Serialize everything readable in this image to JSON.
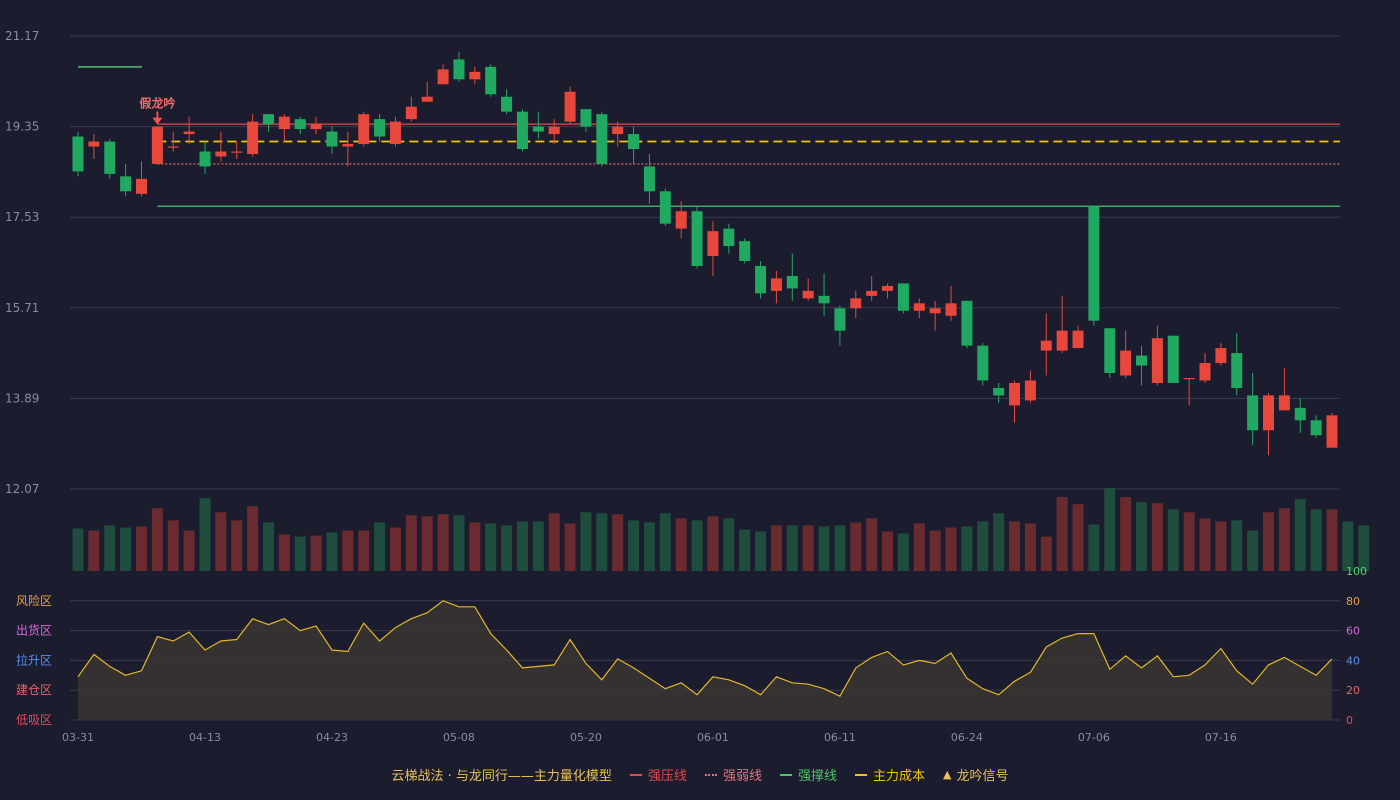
{
  "colors": {
    "background": "#1b1c2e",
    "up": "#e8483b",
    "down": "#21a861",
    "up_volume": "#6a2b30",
    "down_volume": "#1f4d3d",
    "grid": "#3a3b4e",
    "axis_text": "#8a8c9c",
    "pressure_line": "#e5484d",
    "weak_line": "#e5727a",
    "support_line": "#4cc36a",
    "cost_line": "#f1c40f",
    "indicator_line": "#e0b72a",
    "indicator_fill": "#3a3530"
  },
  "chart_data": {
    "type": "candlestick",
    "price_axis": {
      "ticks": [
        "21.17",
        "19.35",
        "17.53",
        "15.71",
        "13.89",
        "12.07"
      ],
      "ylim": [
        12.07,
        21.17
      ]
    },
    "x_tick_labels": [
      {
        "index": 0,
        "label": "03-31"
      },
      {
        "index": 8,
        "label": "04-13"
      },
      {
        "index": 16,
        "label": "04-23"
      },
      {
        "index": 24,
        "label": "05-08"
      },
      {
        "index": 32,
        "label": "05-20"
      },
      {
        "index": 40,
        "label": "06-01"
      },
      {
        "index": 48,
        "label": "06-11"
      },
      {
        "index": 56,
        "label": "06-24"
      },
      {
        "index": 64,
        "label": "07-06"
      },
      {
        "index": 72,
        "label": "07-16"
      }
    ],
    "candles": [
      [
        19.15,
        18.45,
        19.25,
        18.35
      ],
      [
        18.95,
        19.05,
        19.2,
        18.7
      ],
      [
        19.05,
        18.4,
        19.1,
        18.3
      ],
      [
        18.35,
        18.05,
        18.6,
        17.95
      ],
      [
        18.0,
        18.3,
        18.65,
        17.95
      ],
      [
        18.6,
        19.35,
        19.35,
        18.6
      ],
      [
        18.95,
        18.95,
        19.25,
        18.85
      ],
      [
        19.2,
        19.25,
        19.55,
        19.0
      ],
      [
        18.85,
        18.55,
        19.05,
        18.4
      ],
      [
        18.75,
        18.85,
        19.25,
        18.65
      ],
      [
        18.85,
        18.85,
        19.05,
        18.7
      ],
      [
        18.8,
        19.45,
        19.6,
        18.75
      ],
      [
        19.6,
        19.4,
        19.6,
        19.25
      ],
      [
        19.3,
        19.55,
        19.6,
        19.05
      ],
      [
        19.5,
        19.3,
        19.55,
        19.2
      ],
      [
        19.3,
        19.4,
        19.55,
        19.2
      ],
      [
        19.25,
        18.95,
        19.35,
        18.8
      ],
      [
        18.95,
        19.0,
        19.25,
        18.55
      ],
      [
        19.0,
        19.6,
        19.65,
        18.95
      ],
      [
        19.5,
        19.15,
        19.6,
        19.05
      ],
      [
        19.0,
        19.45,
        19.55,
        18.95
      ],
      [
        19.5,
        19.75,
        19.95,
        19.45
      ],
      [
        19.85,
        19.95,
        20.25,
        19.85
      ],
      [
        20.2,
        20.5,
        20.6,
        20.2
      ],
      [
        20.7,
        20.3,
        20.85,
        20.25
      ],
      [
        20.3,
        20.45,
        20.55,
        20.2
      ],
      [
        20.55,
        20.0,
        20.6,
        19.95
      ],
      [
        19.95,
        19.65,
        20.1,
        19.6
      ],
      [
        19.65,
        18.9,
        19.7,
        18.85
      ],
      [
        19.35,
        19.25,
        19.65,
        19.1
      ],
      [
        19.2,
        19.35,
        19.5,
        19.0
      ],
      [
        19.45,
        20.05,
        20.15,
        19.4
      ],
      [
        19.7,
        19.35,
        19.7,
        19.25
      ],
      [
        19.6,
        18.6,
        19.65,
        18.55
      ],
      [
        19.2,
        19.35,
        19.45,
        18.95
      ],
      [
        19.2,
        18.9,
        19.35,
        18.6
      ],
      [
        18.55,
        18.05,
        18.8,
        17.8
      ],
      [
        18.05,
        17.4,
        18.1,
        17.35
      ],
      [
        17.3,
        17.65,
        17.85,
        17.1
      ],
      [
        17.65,
        16.55,
        17.75,
        16.5
      ],
      [
        16.75,
        17.25,
        17.45,
        16.35
      ],
      [
        17.3,
        16.95,
        17.4,
        16.8
      ],
      [
        17.05,
        16.65,
        17.1,
        16.6
      ],
      [
        16.55,
        16.0,
        16.65,
        15.9
      ],
      [
        16.05,
        16.3,
        16.45,
        15.8
      ],
      [
        16.35,
        16.1,
        16.8,
        15.85
      ],
      [
        15.9,
        16.05,
        16.3,
        15.85
      ],
      [
        15.95,
        15.8,
        16.4,
        15.55
      ],
      [
        15.7,
        15.25,
        15.75,
        14.95
      ],
      [
        15.7,
        15.9,
        16.05,
        15.5
      ],
      [
        15.95,
        16.05,
        16.35,
        15.85
      ],
      [
        16.05,
        16.15,
        16.2,
        15.9
      ],
      [
        16.2,
        15.65,
        16.2,
        15.6
      ],
      [
        15.65,
        15.8,
        15.9,
        15.5
      ],
      [
        15.6,
        15.7,
        15.85,
        15.25
      ],
      [
        15.55,
        15.8,
        16.15,
        15.45
      ],
      [
        15.85,
        14.95,
        15.85,
        14.9
      ],
      [
        14.95,
        14.25,
        15.0,
        14.15
      ],
      [
        14.1,
        13.95,
        14.2,
        13.8
      ],
      [
        13.75,
        14.2,
        14.25,
        13.4
      ],
      [
        13.85,
        14.25,
        14.45,
        13.8
      ],
      [
        14.85,
        15.05,
        15.6,
        14.35
      ],
      [
        14.85,
        15.25,
        15.95,
        14.8
      ],
      [
        14.9,
        15.25,
        15.35,
        14.9
      ],
      [
        17.75,
        15.45,
        17.75,
        15.35
      ],
      [
        15.3,
        14.4,
        15.3,
        14.3
      ],
      [
        14.35,
        14.85,
        15.25,
        14.3
      ],
      [
        14.75,
        14.55,
        14.95,
        14.15
      ],
      [
        14.2,
        15.1,
        15.35,
        14.15
      ],
      [
        15.15,
        14.2,
        15.15,
        14.2
      ],
      [
        14.3,
        14.3,
        14.3,
        13.75
      ],
      [
        14.25,
        14.6,
        14.8,
        14.2
      ],
      [
        14.6,
        14.9,
        15.0,
        14.55
      ],
      [
        14.8,
        14.1,
        15.2,
        13.95
      ],
      [
        13.95,
        13.25,
        14.4,
        12.95
      ],
      [
        13.25,
        13.95,
        14.0,
        12.75
      ],
      [
        13.65,
        13.95,
        14.5,
        13.65
      ],
      [
        13.7,
        13.45,
        13.9,
        13.2
      ],
      [
        13.45,
        13.15,
        13.55,
        13.1
      ],
      [
        12.9,
        13.55,
        13.6,
        12.9
      ]
    ],
    "volume": [
      42,
      40,
      45,
      43,
      44,
      62,
      50,
      40,
      72,
      58,
      50,
      64,
      48,
      36,
      34,
      35,
      38,
      40,
      40,
      48,
      43,
      55,
      54,
      56,
      55,
      48,
      47,
      45,
      49,
      49,
      57,
      47,
      58,
      57,
      56,
      50,
      48,
      57,
      52,
      50,
      54,
      52,
      41,
      39,
      45,
      45,
      45,
      44,
      45,
      48,
      52,
      39,
      37,
      47,
      40,
      43,
      44,
      49,
      57,
      49,
      47,
      34,
      73,
      66,
      46,
      82,
      73,
      68,
      67,
      61,
      58,
      52,
      49,
      50,
      40,
      58,
      62,
      71,
      61,
      61,
      49,
      45
    ],
    "pressure_line": 19.4,
    "weak_line": 18.6,
    "support_line": 17.75,
    "cost_line": 19.05,
    "short_green_line": 20.55,
    "signal": {
      "index": 5,
      "label": "假龙吟",
      "price": 19.35
    },
    "indicator": {
      "zones": [
        "风险区",
        "出货区",
        "拉升区",
        "建仓区",
        "低吸区"
      ],
      "ticks": [
        "100",
        "80",
        "60",
        "40",
        "20",
        "0"
      ],
      "ylim": [
        0,
        100
      ],
      "values": [
        29,
        44,
        36,
        30,
        33,
        56,
        53,
        59,
        47,
        53,
        54,
        68,
        64,
        68,
        60,
        63,
        47,
        46,
        65,
        53,
        62,
        68,
        72,
        80,
        76,
        76,
        58,
        47,
        35,
        36,
        37,
        54,
        38,
        27,
        41,
        35,
        28,
        21,
        25,
        17,
        29,
        27,
        23,
        17,
        29,
        25,
        24,
        21,
        16,
        35,
        42,
        46,
        37,
        40,
        38,
        45,
        28,
        21,
        17,
        26,
        32,
        49,
        55,
        58,
        58,
        34,
        43,
        35,
        43,
        29,
        30,
        37,
        48,
        33,
        24,
        37,
        42,
        36,
        30,
        41
      ]
    },
    "legend": [
      {
        "label": "云梯战法 · 与龙同行——主力量化模型",
        "color": "#e8c15a",
        "swatch": "none"
      },
      {
        "label": "强压线",
        "color": "#e5484d",
        "swatch": "solid"
      },
      {
        "label": "强弱线",
        "color": "#e5727a",
        "swatch": "dotted"
      },
      {
        "label": "强撑线",
        "color": "#4cc36a",
        "swatch": "solid"
      },
      {
        "label": "主力成本",
        "color": "#f1c40f",
        "swatch": "dashed"
      },
      {
        "label": "龙吟信号",
        "color": "#e8c15a",
        "swatch": "triangle"
      }
    ]
  }
}
